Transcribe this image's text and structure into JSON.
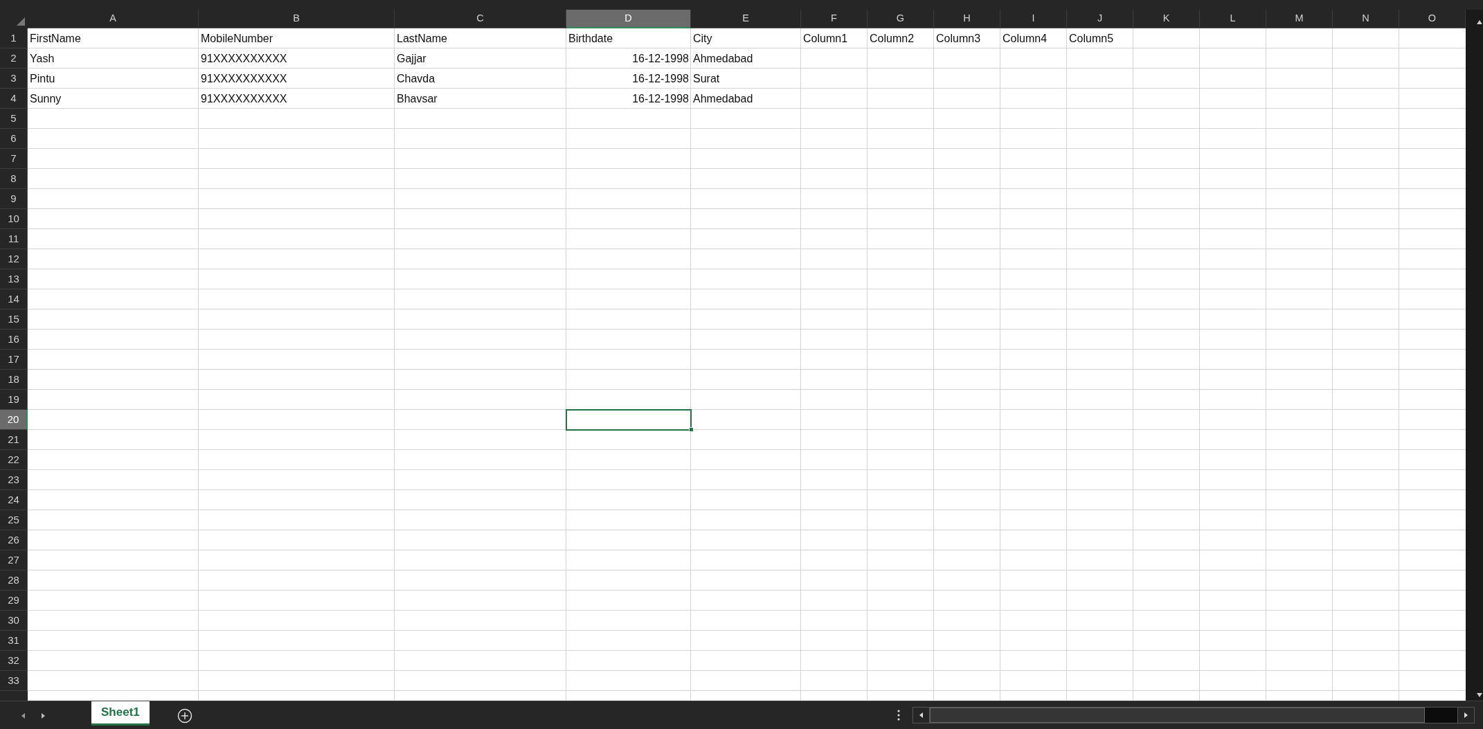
{
  "columns": [
    {
      "label": "A",
      "selected": false
    },
    {
      "label": "B",
      "selected": false
    },
    {
      "label": "C",
      "selected": false
    },
    {
      "label": "D",
      "selected": true
    },
    {
      "label": "E",
      "selected": false
    },
    {
      "label": "F",
      "selected": false
    },
    {
      "label": "G",
      "selected": false
    },
    {
      "label": "H",
      "selected": false
    },
    {
      "label": "I",
      "selected": false
    },
    {
      "label": "J",
      "selected": false
    },
    {
      "label": "K",
      "selected": false
    },
    {
      "label": "L",
      "selected": false
    },
    {
      "label": "M",
      "selected": false
    },
    {
      "label": "N",
      "selected": false
    },
    {
      "label": "O",
      "selected": false
    }
  ],
  "rows": [
    {
      "number": "1",
      "selected": false,
      "cells": [
        {
          "text": "FirstName",
          "kind": "text"
        },
        {
          "text": "MobileNumber",
          "kind": "text"
        },
        {
          "text": "LastName",
          "kind": "text"
        },
        {
          "text": "Birthdate",
          "kind": "text"
        },
        {
          "text": "City",
          "kind": "text"
        },
        {
          "text": "Column1",
          "kind": "text"
        },
        {
          "text": "Column2",
          "kind": "text"
        },
        {
          "text": "Column3",
          "kind": "text"
        },
        {
          "text": "Column4",
          "kind": "text"
        },
        {
          "text": "Column5",
          "kind": "text"
        }
      ]
    },
    {
      "number": "2",
      "selected": false,
      "cells": [
        {
          "text": "Yash",
          "kind": "text"
        },
        {
          "text": "91XXXXXXXXXX",
          "kind": "text"
        },
        {
          "text": "Gajjar",
          "kind": "text"
        },
        {
          "text": "16-12-1998",
          "kind": "number"
        },
        {
          "text": "Ahmedabad",
          "kind": "text"
        }
      ]
    },
    {
      "number": "3",
      "selected": false,
      "cells": [
        {
          "text": "Pintu",
          "kind": "text"
        },
        {
          "text": "91XXXXXXXXXX",
          "kind": "text"
        },
        {
          "text": "Chavda",
          "kind": "text"
        },
        {
          "text": "16-12-1998",
          "kind": "number"
        },
        {
          "text": "Surat",
          "kind": "text"
        }
      ]
    },
    {
      "number": "4",
      "selected": false,
      "cells": [
        {
          "text": "Sunny",
          "kind": "text"
        },
        {
          "text": "91XXXXXXXXXX",
          "kind": "text"
        },
        {
          "text": "Bhavsar",
          "kind": "text"
        },
        {
          "text": "16-12-1998",
          "kind": "number"
        },
        {
          "text": "Ahmedabad",
          "kind": "text"
        }
      ]
    },
    {
      "number": "5",
      "selected": false
    },
    {
      "number": "6",
      "selected": false
    },
    {
      "number": "7",
      "selected": false
    },
    {
      "number": "8",
      "selected": false
    },
    {
      "number": "9",
      "selected": false
    },
    {
      "number": "10",
      "selected": false
    },
    {
      "number": "11",
      "selected": false
    },
    {
      "number": "12",
      "selected": false
    },
    {
      "number": "13",
      "selected": false
    },
    {
      "number": "14",
      "selected": false
    },
    {
      "number": "15",
      "selected": false
    },
    {
      "number": "16",
      "selected": false
    },
    {
      "number": "17",
      "selected": false
    },
    {
      "number": "18",
      "selected": false
    },
    {
      "number": "19",
      "selected": false
    },
    {
      "number": "20",
      "selected": true
    },
    {
      "number": "21",
      "selected": false
    },
    {
      "number": "22",
      "selected": false
    },
    {
      "number": "23",
      "selected": false
    },
    {
      "number": "24",
      "selected": false
    },
    {
      "number": "25",
      "selected": false
    },
    {
      "number": "26",
      "selected": false
    },
    {
      "number": "27",
      "selected": false
    },
    {
      "number": "28",
      "selected": false
    },
    {
      "number": "29",
      "selected": false
    },
    {
      "number": "30",
      "selected": false
    },
    {
      "number": "31",
      "selected": false
    },
    {
      "number": "32",
      "selected": false
    },
    {
      "number": "33",
      "selected": false
    }
  ],
  "sheet_tabs": [
    {
      "label": "Sheet1",
      "selected": true
    }
  ]
}
